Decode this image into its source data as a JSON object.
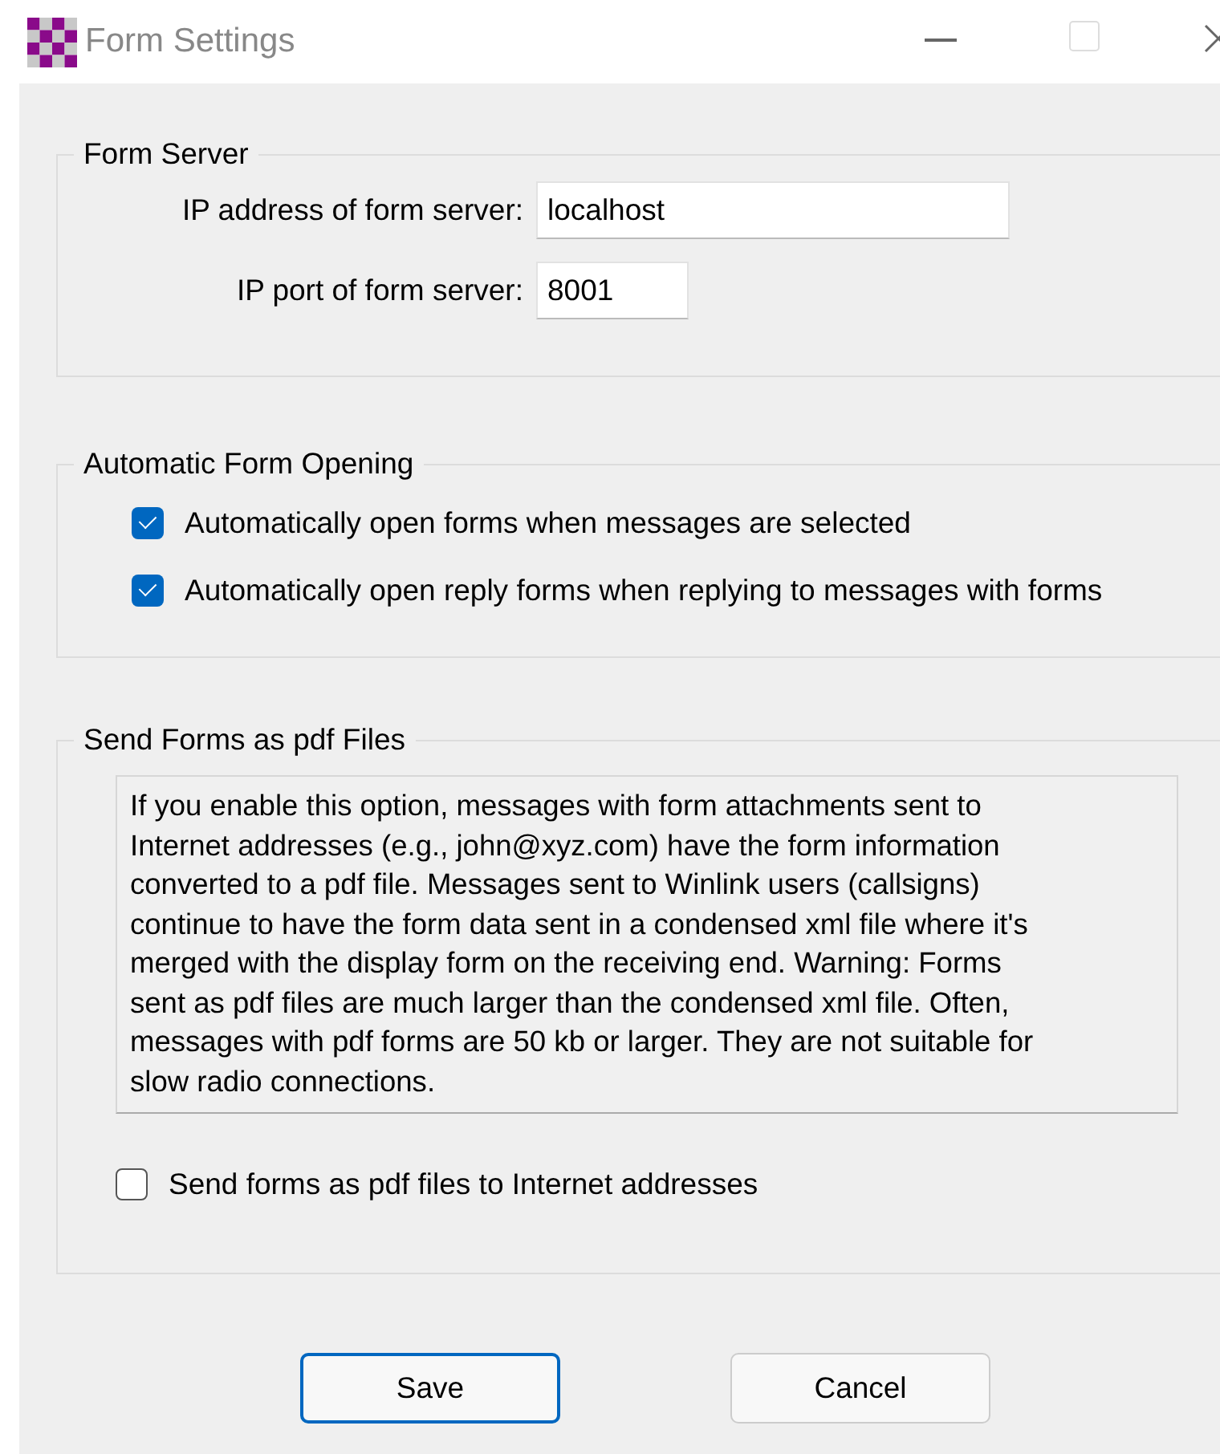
{
  "window": {
    "title": "Form Settings"
  },
  "form_server": {
    "title": "Form Server",
    "fields": [
      {
        "label": "IP address of form server:",
        "value": "localhost",
        "kind": "wide"
      },
      {
        "label": "IP port of form server:",
        "value": "8001",
        "kind": "narrow"
      }
    ]
  },
  "automatic_form_opening": {
    "title": "Automatic Form Opening",
    "options": [
      {
        "label": "Automatically open forms when messages are selected",
        "checked": true
      },
      {
        "label": "Automatically open reply forms when replying to messages with forms",
        "checked": true
      }
    ]
  },
  "send_forms_as_pdf": {
    "title": "Send Forms as pdf Files",
    "description": "If you enable this option, messages with form attachments sent to Internet addresses (e.g., john@xyz.com) have the form information converted to a pdf file.  Messages sent to Winlink users (callsigns) continue to have the form data sent in a condensed xml file where it's merged with the display form on the receiving end.  Warning: Forms sent as pdf files are much larger than the condensed xml file.  Often, messages with pdf forms are 50 kb or larger. They are not suitable for slow radio connections.",
    "option": {
      "label": "Send forms as pdf files to Internet addresses",
      "checked": false
    }
  },
  "buttons": [
    {
      "label": "Save",
      "selected": true
    },
    {
      "label": "Cancel",
      "selected": false
    }
  ]
}
